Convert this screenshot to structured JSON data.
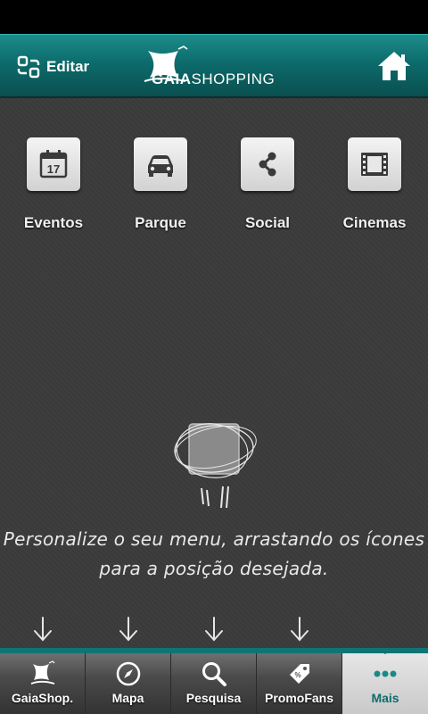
{
  "header": {
    "edit_label": "Editar",
    "logo_text_bold": "GAIA",
    "logo_text": "SHOPPING"
  },
  "shortcuts": [
    {
      "label": "Eventos",
      "icon": "calendar-icon",
      "calendar_day": "17"
    },
    {
      "label": "Parque",
      "icon": "car-icon"
    },
    {
      "label": "Social",
      "icon": "share-icon"
    },
    {
      "label": "Cinemas",
      "icon": "film-icon"
    }
  ],
  "hint": {
    "line1": "Personalize o seu menu, arrastando os ícones",
    "line2": "para a posição desejada."
  },
  "tabs": [
    {
      "label": "GaiaShop.",
      "icon": "gaia-logo-icon"
    },
    {
      "label": "Mapa",
      "icon": "compass-icon"
    },
    {
      "label": "Pesquisa",
      "icon": "search-icon"
    },
    {
      "label": "PromoFans",
      "icon": "tag-icon"
    },
    {
      "label": "Mais",
      "icon": "more-dots-icon",
      "active": true
    }
  ],
  "colors": {
    "accent": "#0e7574",
    "header_top": "#1c8d8b",
    "background": "#3b3b3b"
  }
}
